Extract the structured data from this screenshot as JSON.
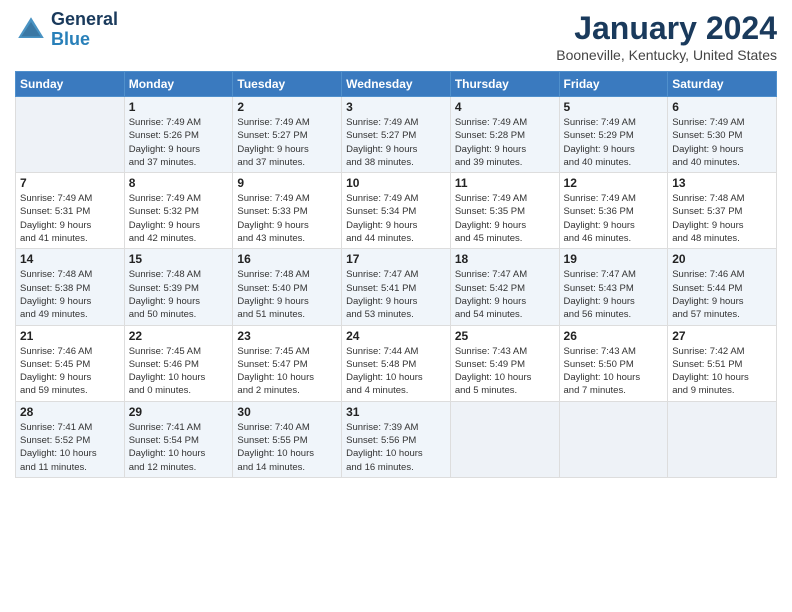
{
  "header": {
    "logo_line1": "General",
    "logo_line2": "Blue",
    "title": "January 2024",
    "subtitle": "Booneville, Kentucky, United States"
  },
  "days_of_week": [
    "Sunday",
    "Monday",
    "Tuesday",
    "Wednesday",
    "Thursday",
    "Friday",
    "Saturday"
  ],
  "weeks": [
    [
      {
        "day": "",
        "info": ""
      },
      {
        "day": "1",
        "info": "Sunrise: 7:49 AM\nSunset: 5:26 PM\nDaylight: 9 hours\nand 37 minutes."
      },
      {
        "day": "2",
        "info": "Sunrise: 7:49 AM\nSunset: 5:27 PM\nDaylight: 9 hours\nand 37 minutes."
      },
      {
        "day": "3",
        "info": "Sunrise: 7:49 AM\nSunset: 5:27 PM\nDaylight: 9 hours\nand 38 minutes."
      },
      {
        "day": "4",
        "info": "Sunrise: 7:49 AM\nSunset: 5:28 PM\nDaylight: 9 hours\nand 39 minutes."
      },
      {
        "day": "5",
        "info": "Sunrise: 7:49 AM\nSunset: 5:29 PM\nDaylight: 9 hours\nand 40 minutes."
      },
      {
        "day": "6",
        "info": "Sunrise: 7:49 AM\nSunset: 5:30 PM\nDaylight: 9 hours\nand 40 minutes."
      }
    ],
    [
      {
        "day": "7",
        "info": "Sunrise: 7:49 AM\nSunset: 5:31 PM\nDaylight: 9 hours\nand 41 minutes."
      },
      {
        "day": "8",
        "info": "Sunrise: 7:49 AM\nSunset: 5:32 PM\nDaylight: 9 hours\nand 42 minutes."
      },
      {
        "day": "9",
        "info": "Sunrise: 7:49 AM\nSunset: 5:33 PM\nDaylight: 9 hours\nand 43 minutes."
      },
      {
        "day": "10",
        "info": "Sunrise: 7:49 AM\nSunset: 5:34 PM\nDaylight: 9 hours\nand 44 minutes."
      },
      {
        "day": "11",
        "info": "Sunrise: 7:49 AM\nSunset: 5:35 PM\nDaylight: 9 hours\nand 45 minutes."
      },
      {
        "day": "12",
        "info": "Sunrise: 7:49 AM\nSunset: 5:36 PM\nDaylight: 9 hours\nand 46 minutes."
      },
      {
        "day": "13",
        "info": "Sunrise: 7:48 AM\nSunset: 5:37 PM\nDaylight: 9 hours\nand 48 minutes."
      }
    ],
    [
      {
        "day": "14",
        "info": "Sunrise: 7:48 AM\nSunset: 5:38 PM\nDaylight: 9 hours\nand 49 minutes."
      },
      {
        "day": "15",
        "info": "Sunrise: 7:48 AM\nSunset: 5:39 PM\nDaylight: 9 hours\nand 50 minutes."
      },
      {
        "day": "16",
        "info": "Sunrise: 7:48 AM\nSunset: 5:40 PM\nDaylight: 9 hours\nand 51 minutes."
      },
      {
        "day": "17",
        "info": "Sunrise: 7:47 AM\nSunset: 5:41 PM\nDaylight: 9 hours\nand 53 minutes."
      },
      {
        "day": "18",
        "info": "Sunrise: 7:47 AM\nSunset: 5:42 PM\nDaylight: 9 hours\nand 54 minutes."
      },
      {
        "day": "19",
        "info": "Sunrise: 7:47 AM\nSunset: 5:43 PM\nDaylight: 9 hours\nand 56 minutes."
      },
      {
        "day": "20",
        "info": "Sunrise: 7:46 AM\nSunset: 5:44 PM\nDaylight: 9 hours\nand 57 minutes."
      }
    ],
    [
      {
        "day": "21",
        "info": "Sunrise: 7:46 AM\nSunset: 5:45 PM\nDaylight: 9 hours\nand 59 minutes."
      },
      {
        "day": "22",
        "info": "Sunrise: 7:45 AM\nSunset: 5:46 PM\nDaylight: 10 hours\nand 0 minutes."
      },
      {
        "day": "23",
        "info": "Sunrise: 7:45 AM\nSunset: 5:47 PM\nDaylight: 10 hours\nand 2 minutes."
      },
      {
        "day": "24",
        "info": "Sunrise: 7:44 AM\nSunset: 5:48 PM\nDaylight: 10 hours\nand 4 minutes."
      },
      {
        "day": "25",
        "info": "Sunrise: 7:43 AM\nSunset: 5:49 PM\nDaylight: 10 hours\nand 5 minutes."
      },
      {
        "day": "26",
        "info": "Sunrise: 7:43 AM\nSunset: 5:50 PM\nDaylight: 10 hours\nand 7 minutes."
      },
      {
        "day": "27",
        "info": "Sunrise: 7:42 AM\nSunset: 5:51 PM\nDaylight: 10 hours\nand 9 minutes."
      }
    ],
    [
      {
        "day": "28",
        "info": "Sunrise: 7:41 AM\nSunset: 5:52 PM\nDaylight: 10 hours\nand 11 minutes."
      },
      {
        "day": "29",
        "info": "Sunrise: 7:41 AM\nSunset: 5:54 PM\nDaylight: 10 hours\nand 12 minutes."
      },
      {
        "day": "30",
        "info": "Sunrise: 7:40 AM\nSunset: 5:55 PM\nDaylight: 10 hours\nand 14 minutes."
      },
      {
        "day": "31",
        "info": "Sunrise: 7:39 AM\nSunset: 5:56 PM\nDaylight: 10 hours\nand 16 minutes."
      },
      {
        "day": "",
        "info": ""
      },
      {
        "day": "",
        "info": ""
      },
      {
        "day": "",
        "info": ""
      }
    ]
  ]
}
